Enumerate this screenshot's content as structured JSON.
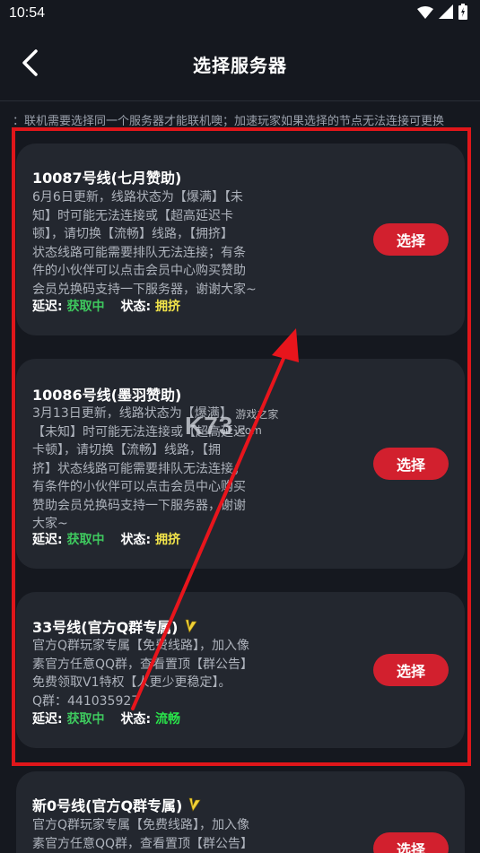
{
  "status_bar": {
    "time": "10:54"
  },
  "header": {
    "title": "选择服务器"
  },
  "notice": "：联机需要选择同一个服务器才能联机噢；加速玩家如果选择的节点无法连接可更换",
  "labels": {
    "delay": "延迟:",
    "status": "状态:",
    "select": "选择"
  },
  "servers": [
    {
      "name": "10087号线(七月赞助)",
      "vip": false,
      "description": [
        "6月6日更新，线路状态为【爆满】【未",
        "知】时可能无法连接或【超高延迟卡",
        "顿】，请切换【流畅】线路，【拥挤】",
        "状态线路可能需要排队无法连接；有条",
        "件的小伙伴可以点击会员中心购买赞助",
        "会员兑换码支持一下服务器，谢谢大家~"
      ],
      "delay": "获取中",
      "status": "拥挤"
    },
    {
      "name": "10086号线(墨羽赞助)",
      "vip": false,
      "description": [
        "3月13日更新，线路状态为【爆满】",
        "【未知】时可能无法连接或【超高延迟",
        "卡顿】，请切换【流畅】线路，【拥",
        "挤】状态线路可能需要排队无法连接；",
        "有条件的小伙伴可以点击会员中心购买",
        "赞助会员兑换码支持一下服务器，谢谢",
        "大家~"
      ],
      "delay": "获取中",
      "status": "拥挤"
    },
    {
      "name": "33号线(官方Q群专属)",
      "vip": true,
      "description": [
        "官方Q群玩家专属【免费线路】，加入像",
        "素官方任意QQ群，查看置顶【群公告】",
        "免费领取V1特权【人更少更稳定】。",
        "Q群：441035927"
      ],
      "delay": "获取中",
      "status": "流畅"
    },
    {
      "name": "新0号线(官方Q群专属)",
      "vip": true,
      "description": [
        "官方Q群玩家专属【免费线路】，加入像",
        "素官方任意QQ群，查看置顶【群公告】"
      ],
      "delay": "",
      "status": ""
    }
  ],
  "watermark": {
    "logo": "K73",
    "cn": "游戏之家",
    "domain": ".com"
  },
  "colors": {
    "select_button": "#d2202e",
    "highlight_border": "#e0161a",
    "delay_value": "#3ec95e",
    "status_crowded": "#f2e44a",
    "status_smooth": "#29e34a"
  },
  "icons": {
    "back": "chevron-left-icon",
    "wifi": "wifi-icon",
    "signal": "signal-icon",
    "battery": "battery-icon",
    "vip": "vip-v-badge-icon",
    "annotation": "red-arrow-icon"
  }
}
